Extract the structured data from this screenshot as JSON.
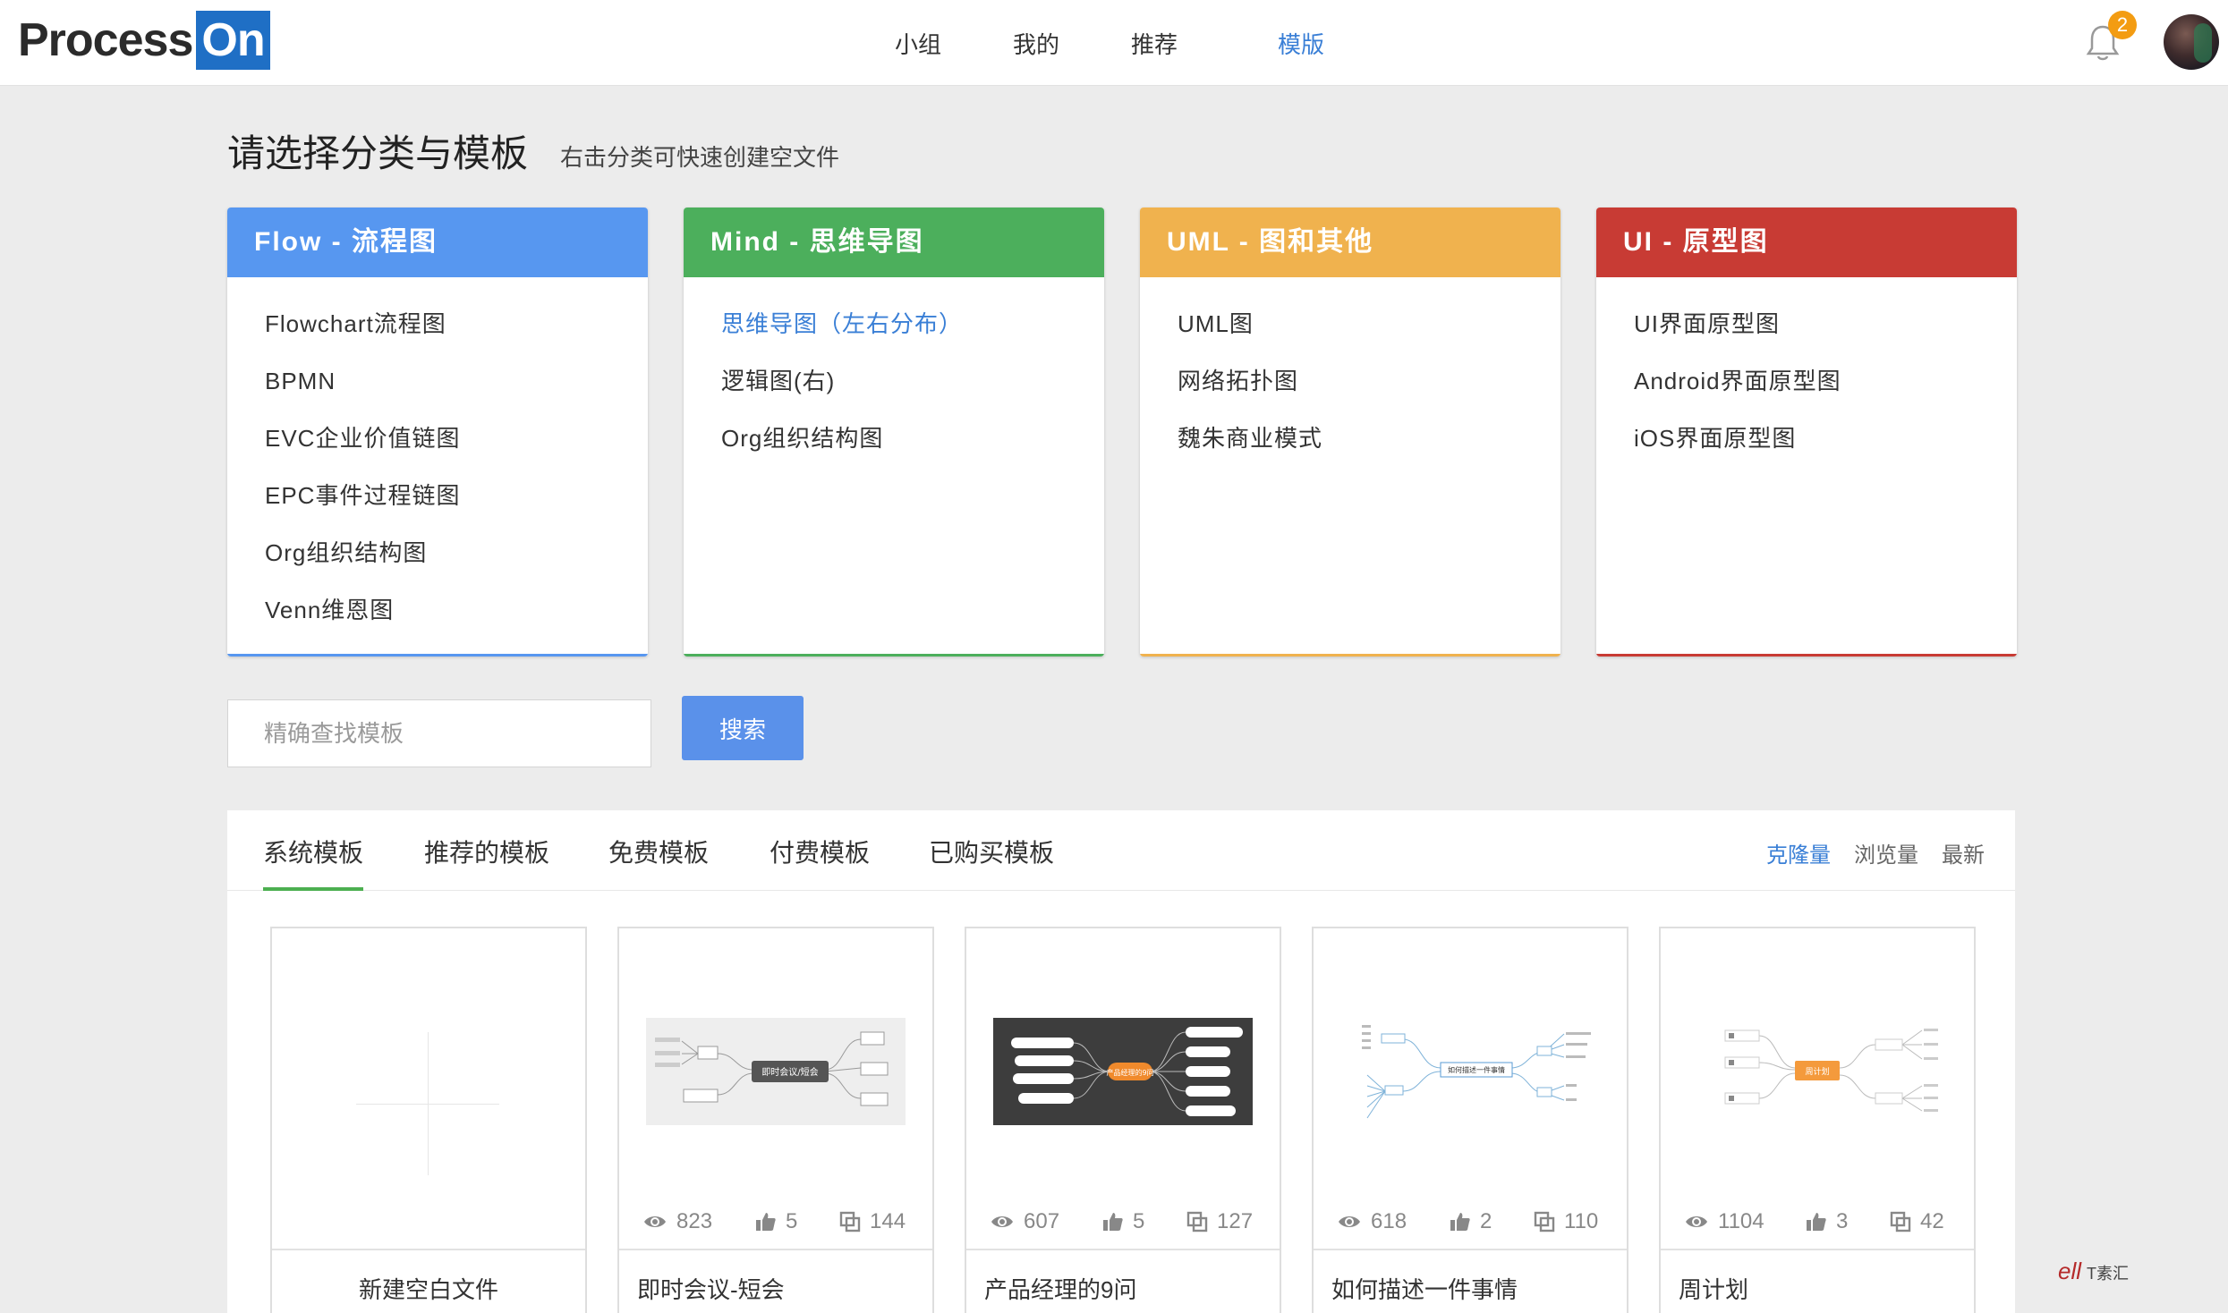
{
  "header": {
    "logo_process": "Process",
    "logo_on": "On",
    "nav": [
      "小组",
      "我的",
      "推荐",
      "模版"
    ],
    "notification_count": "2"
  },
  "title": {
    "main": "请选择分类与模板",
    "sub": "右击分类可快速创建空文件"
  },
  "categories": [
    {
      "title": "Flow - 流程图",
      "color": "#5797f0",
      "items": [
        "Flowchart流程图",
        "BPMN",
        "EVC企业价值链图",
        "EPC事件过程链图",
        "Org组织结构图",
        "Venn维恩图"
      ]
    },
    {
      "title": "Mind - 思维导图",
      "color": "#4caf5c",
      "items": [
        "思维导图（左右分布）",
        "逻辑图(右)",
        "Org组织结构图"
      ]
    },
    {
      "title": "UML - 图和其他",
      "color": "#f0b24e",
      "items": [
        "UML图",
        "网络拓扑图",
        "魏朱商业模式"
      ]
    },
    {
      "title": "UI - 原型图",
      "color": "#c83b34",
      "items": [
        "UI界面原型图",
        "Android界面原型图",
        "iOS界面原型图"
      ]
    }
  ],
  "search": {
    "placeholder": "精确查找模板",
    "button": "搜索"
  },
  "tabs": [
    "系统模板",
    "推荐的模板",
    "免费模板",
    "付费模板",
    "已购买模板"
  ],
  "sort": [
    "克隆量",
    "浏览量",
    "最新"
  ],
  "templates": [
    {
      "name": "新建空白文件"
    },
    {
      "name": "即时会议-短会",
      "views": "823",
      "likes": "5",
      "clones": "144"
    },
    {
      "name": "产品经理的9问",
      "views": "607",
      "likes": "5",
      "clones": "127"
    },
    {
      "name": "如何描述一件事情",
      "views": "618",
      "likes": "2",
      "clones": "110"
    },
    {
      "name": "周计划",
      "views": "1104",
      "likes": "3",
      "clones": "42"
    }
  ],
  "thumb_text": {
    "t1": "即时会议/短会",
    "t2": "产品经理的9问",
    "t3": "如何描述一件事情",
    "t4": "周计划"
  },
  "watermark": {
    "mark": "ell",
    "text": "T素汇"
  },
  "colors": {
    "accent": "#3a7fd6",
    "search_button": "#5a91ea",
    "tab_underline": "#4caf50",
    "badge": "#f39c12"
  }
}
